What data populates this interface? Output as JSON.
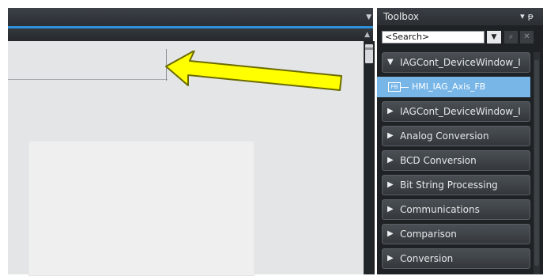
{
  "toolbox": {
    "title": "Toolbox",
    "search_value": "<Search>",
    "items": [
      {
        "label": "IAGCont_DeviceWindow_I",
        "expanded": true
      },
      {
        "label": "HMI_IAG_Axis_FB",
        "type": "fb",
        "badge": "FB"
      },
      {
        "label": "IAGCont_DeviceWindow_I",
        "expanded": false
      },
      {
        "label": "Analog Conversion"
      },
      {
        "label": "BCD Conversion"
      },
      {
        "label": "Bit String Processing"
      },
      {
        "label": "Communications"
      },
      {
        "label": "Comparison"
      },
      {
        "label": "Conversion"
      }
    ]
  },
  "icons": {
    "pin": "pin-icon",
    "dropdown": "chevron-down-icon",
    "search": "search-icon",
    "close": "close-icon"
  },
  "colors": {
    "accent_blue": "#2f8fd8",
    "selected_item": "#79b6e8",
    "arrow_fill": "#ffff00",
    "arrow_stroke": "#6b6b00"
  }
}
